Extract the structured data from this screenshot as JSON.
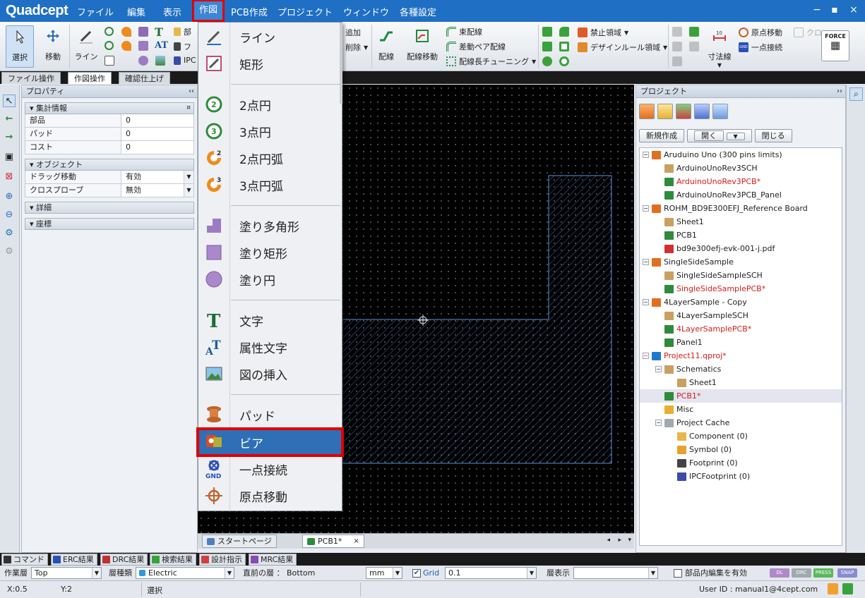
{
  "app": {
    "logo": "Quadcept",
    "menus": [
      "ファイル",
      "編集",
      "表示",
      "作図",
      "PCB作成",
      "プロジェクト",
      "ウィンドウ",
      "各種設定"
    ],
    "window_controls": [
      "−",
      "▪",
      "×"
    ]
  },
  "ribbon": {
    "select": "選択",
    "move": "移動",
    "line": "ライン",
    "parts_a": "部",
    "parts_b": "フ",
    "parts_c": "IPC",
    "add": "追加",
    "delete": "削除",
    "wiring": "配線",
    "wiring_move": "配線移動",
    "bundle": "束配線",
    "diff_pair": "差動ペア配線",
    "length_tuning": "配線長チューニング",
    "keepout": "禁止領域",
    "design_rule": "デザインルール領域",
    "dimension": "寸法線",
    "origin_move": "原点移動",
    "single_point": "一点接続",
    "clone": "クロ",
    "force": "FORCE"
  },
  "ribbon_tabs": [
    "ファイル操作",
    "作図操作",
    "確認仕上げ"
  ],
  "properties": {
    "title": "プロパティ",
    "sections": {
      "summary": "集計情報",
      "object": "オブジェクト",
      "detail": "詳細",
      "coords": "座標"
    },
    "summary_rows": [
      {
        "key": "部品",
        "value": "0"
      },
      {
        "key": "パッド",
        "value": "0"
      },
      {
        "key": "コスト",
        "value": "0"
      }
    ],
    "object_rows": [
      {
        "key": "ドラッグ移動",
        "value": "有効"
      },
      {
        "key": "クロスプローブ",
        "value": "無効"
      }
    ]
  },
  "dropdown": {
    "items": [
      "ライン",
      "矩形",
      "2点円",
      "3点円",
      "2点円弧",
      "3点円弧",
      "塗り多角形",
      "塗り矩形",
      "塗り円",
      "文字",
      "属性文字",
      "図の挿入",
      "パッド",
      "ビア",
      "一点接続",
      "原点移動"
    ],
    "highlighted": "ビア"
  },
  "doc_tabs": [
    "スタートページ",
    "PCB1*"
  ],
  "project": {
    "title": "プロジェクト",
    "buttons": [
      "新規作成",
      "開く",
      "閉じる"
    ],
    "tree": [
      {
        "label": "Aruduino Uno (300 pins limits)",
        "type": "PRJ",
        "level": 0,
        "toggle": "−",
        "modified": false
      },
      {
        "label": "ArduinoUnoRev3SCH",
        "type": "SCH",
        "level": 1,
        "modified": false
      },
      {
        "label": "ArduinoUnoRev3PCB*",
        "type": "PCB",
        "level": 1,
        "modified": true
      },
      {
        "label": "ArduinoUnoRev3PCB_Panel",
        "type": "PNL",
        "level": 1,
        "modified": false
      },
      {
        "label": "ROHM_BD9E300EFJ_Reference Board",
        "type": "PRJ",
        "level": 0,
        "toggle": "−",
        "modified": false
      },
      {
        "label": "Sheet1",
        "type": "SCH",
        "level": 1,
        "modified": false
      },
      {
        "label": "PCB1",
        "type": "PCB",
        "level": 1,
        "modified": false
      },
      {
        "label": "bd9e300efj-evk-001-j.pdf",
        "type": "PDF",
        "level": 1,
        "modified": false
      },
      {
        "label": "SingleSideSample",
        "type": "PRJ",
        "level": 0,
        "toggle": "−",
        "modified": false
      },
      {
        "label": "SingleSideSampleSCH",
        "type": "SCH",
        "level": 1,
        "modified": false
      },
      {
        "label": "SingleSideSamplePCB*",
        "type": "PCB",
        "level": 1,
        "modified": true
      },
      {
        "label": "4LayerSample - Copy",
        "type": "PRJ",
        "level": 0,
        "toggle": "−",
        "modified": false
      },
      {
        "label": "4LayerSampleSCH",
        "type": "SCH",
        "level": 1,
        "modified": false
      },
      {
        "label": "4LayerSamplePCB*",
        "type": "PCB",
        "level": 1,
        "modified": true
      },
      {
        "label": "Panel1",
        "type": "PNL",
        "level": 1,
        "modified": false
      },
      {
        "label": "Project11.qproj*",
        "type": "QPJ",
        "level": 0,
        "toggle": "−",
        "modified": true
      },
      {
        "label": "Schematics",
        "type": "SCH",
        "level": 1,
        "toggle": "−",
        "modified": false
      },
      {
        "label": "Sheet1",
        "type": "SCH",
        "level": 2,
        "modified": false
      },
      {
        "label": "PCB1*",
        "type": "PCB",
        "level": 1,
        "modified": true,
        "selected": true
      },
      {
        "label": "Misc",
        "type": "DIR",
        "level": 1,
        "modified": false
      },
      {
        "label": "Project Cache",
        "type": "DB",
        "level": 1,
        "toggle": "−",
        "modified": false
      },
      {
        "label": "Component (0)",
        "type": "CMP",
        "level": 2,
        "modified": false
      },
      {
        "label": "Symbol (0)",
        "type": "SYM",
        "level": 2,
        "modified": false
      },
      {
        "label": "Footprint (0)",
        "type": "FP",
        "level": 2,
        "modified": false
      },
      {
        "label": "IPCFootprint (0)",
        "type": "IPC",
        "level": 2,
        "modified": false
      }
    ]
  },
  "output_tabs": [
    "コマンド",
    "ERC結果",
    "DRC結果",
    "検索結果",
    "設計指示",
    "MRC結果"
  ],
  "layerbar": {
    "work_layer_label": "作業層",
    "work_layer_value": "Top",
    "layer_kind_label": "層種類",
    "layer_kind_value": "Electric",
    "prev_layer": "直前の層 ： Bottom",
    "unit": "mm",
    "grid_label": "Grid",
    "grid_value": "0.1",
    "layer_display_label": "層表示",
    "parts_edit": "部品内編集を有効",
    "badges": [
      "DL",
      "DRC",
      "PRESS",
      "SNAP"
    ]
  },
  "status": {
    "x": "X:0.5",
    "y": "Y:2",
    "mode": "選択",
    "user": "User ID : manual1@4cept.com"
  },
  "colors": {
    "titlebar": "#1f6fc4",
    "highlight_outline": "#e00000",
    "menu_highlight": "#2f6fb5",
    "modified_text": "#d81b1b",
    "canvas": "#000000",
    "copper_outline": "#5b8fd6"
  }
}
